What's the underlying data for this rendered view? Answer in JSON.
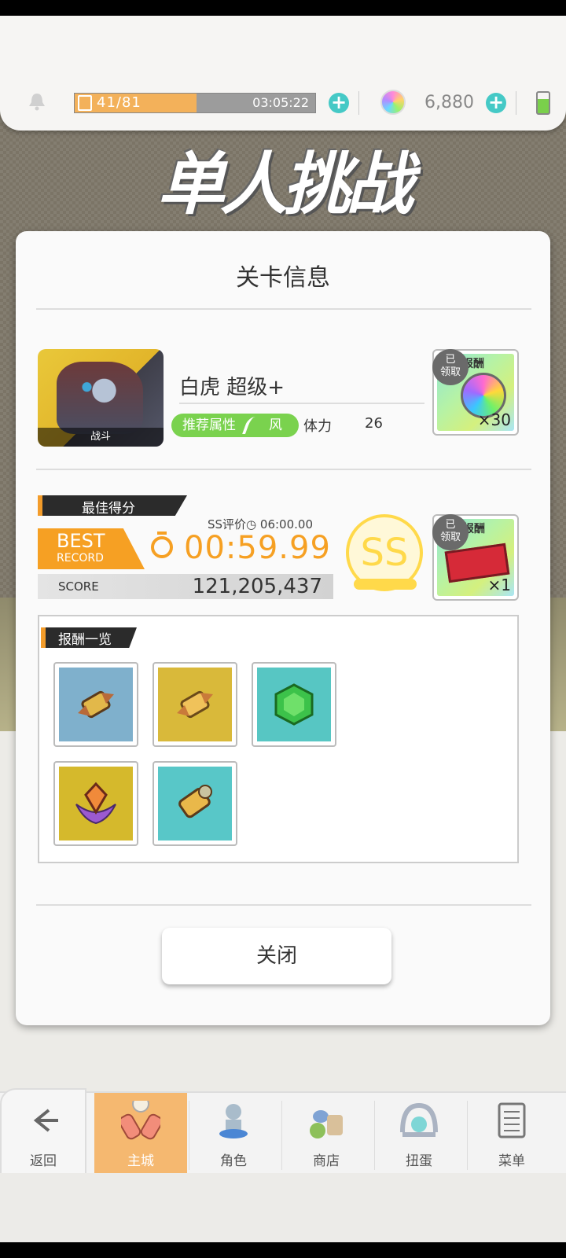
{
  "status": {
    "stamina": "41/81",
    "stamina_fraction": 0.506,
    "timer": "03:05:22",
    "gems": "6,880"
  },
  "header": {
    "title_graphic": "单人挑战"
  },
  "dialog": {
    "title": "关卡信息",
    "stage": {
      "image_label": "战斗",
      "name": "白虎 超级+",
      "attr_label": "推荐属性",
      "attr_value": "风",
      "stamina_label": "体力",
      "stamina_cost": "26"
    },
    "first_reward": {
      "header": "次报酬",
      "badge": "已\n领取",
      "qty": "×30"
    },
    "best": {
      "banner": "最佳得分",
      "ss_time_label": "SS评价◷ 06:00.00",
      "best_word": "BEST",
      "record_word": "RECORD",
      "time": "00:59.99",
      "score_label": "SCORE",
      "score": "121,205,437",
      "rank": "SS"
    },
    "ss_reward": {
      "header": "S 报酬",
      "badge": "已\n领取",
      "qty": "×1"
    },
    "rewards": {
      "title": "报酬一览",
      "items": [
        {
          "icon": "blue-scroll-icon",
          "bg": "#7fb0cc"
        },
        {
          "icon": "gold-scroll-icon",
          "bg": "#d9b93a"
        },
        {
          "icon": "green-gem-icon",
          "bg": "#57c6c3"
        },
        {
          "icon": "purple-crystal-icon",
          "bg": "#d5b92c"
        },
        {
          "icon": "rainbow-scroll-icon",
          "bg": "#58c7c8"
        }
      ]
    },
    "close_label": "关闭"
  },
  "nav": {
    "back": "返回",
    "main": "主城",
    "character": "角色",
    "shop": "商店",
    "gacha": "扭蛋",
    "menu": "菜单"
  },
  "colors": {
    "accent": "#f6a023",
    "teal": "#45c9c6",
    "green": "#7ad24e"
  }
}
